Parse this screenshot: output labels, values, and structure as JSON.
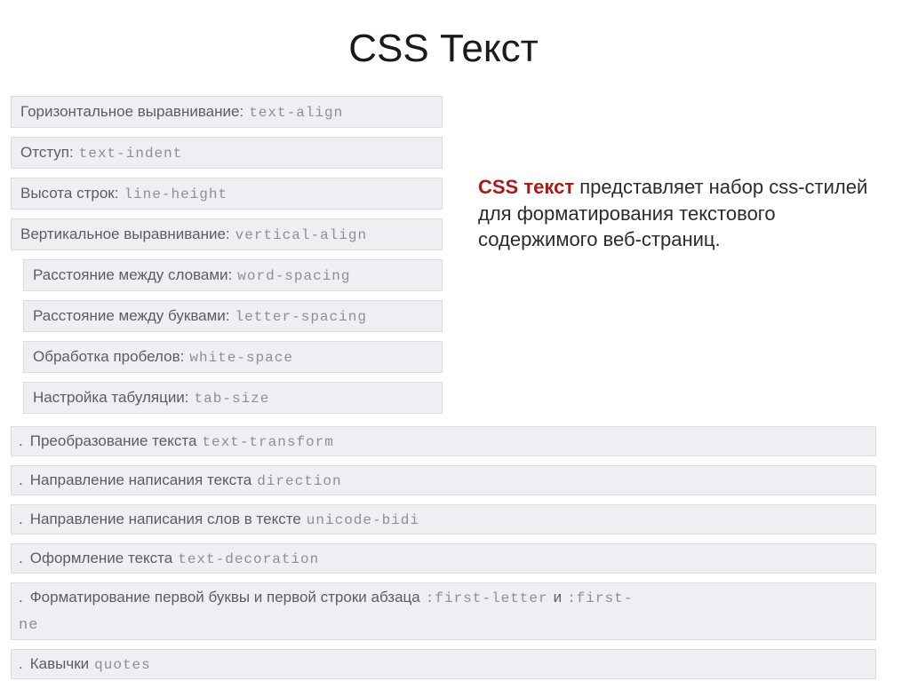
{
  "title": "CSS Текст",
  "desc": {
    "strong": "CSS текст",
    "body": " представляет набор css-стилей для форматирования текстового содержимого веб-страниц."
  },
  "left_rows": [
    {
      "label": "Горизонтальное выравнивание:",
      "code": "text-align",
      "indent": 0
    },
    {
      "label": "Отступ:",
      "code": "text-indent",
      "indent": 0
    },
    {
      "label": "Высота строк:",
      "code": "line-height",
      "indent": 0
    },
    {
      "label": "Вертикальное выравнивание:",
      "code": "vertical-align",
      "indent": 0
    },
    {
      "label": "Расстояние между словами:",
      "code": "word-spacing",
      "indent": 1
    },
    {
      "label": "Расстояние между буквами:",
      "code": "letter-spacing",
      "indent": 1
    },
    {
      "label": "Обработка пробелов:",
      "code": "white-space",
      "indent": 1
    },
    {
      "label": "Настройка табуляции:",
      "code": "tab-size",
      "indent": 1
    }
  ],
  "bottom_rows": [
    {
      "prefix": ".",
      "label": "Преобразование текста",
      "code": "text-transform"
    },
    {
      "prefix": ".",
      "label": "Направление написания текста",
      "code": "direction"
    },
    {
      "prefix": ".",
      "label": "Направление написания слов в тексте",
      "code": "unicode-bidi"
    },
    {
      "prefix": ".",
      "label": "Оформление текста",
      "code": "text-decoration"
    }
  ],
  "special_row": {
    "prefix": ".",
    "label": "Форматирование первой буквы и первой строки абзаца",
    "code1": ":first-letter",
    "sep": "и",
    "code2": ":first-",
    "trail": "ne"
  },
  "last_row": {
    "prefix": ".",
    "label": "Кавычки",
    "code": "quotes"
  }
}
